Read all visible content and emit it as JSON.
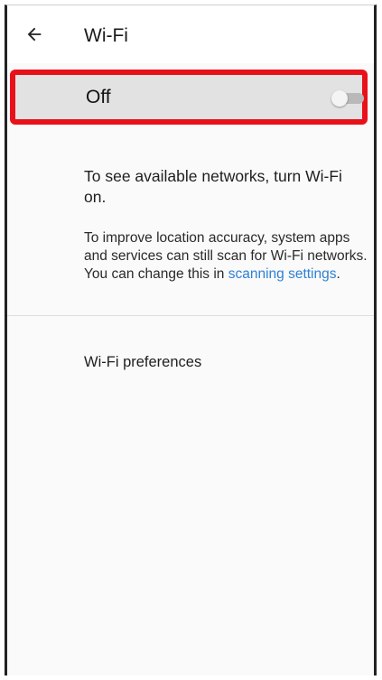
{
  "header": {
    "title": "Wi-Fi",
    "back_icon": "arrow-left-icon"
  },
  "wifi_toggle": {
    "label": "Off",
    "state": "off",
    "highlight_color": "#e8111a"
  },
  "info": {
    "primary": "To see available networks, turn Wi-Fi on.",
    "secondary_before": "To improve location accuracy, system apps and services can still scan for Wi-Fi networks. You can change this in ",
    "secondary_link": "scanning settings",
    "secondary_after": "."
  },
  "preferences": {
    "label": "Wi-Fi preferences"
  },
  "colors": {
    "link": "#2f7fd4",
    "toggle_row_bg": "#e2e2e2"
  }
}
